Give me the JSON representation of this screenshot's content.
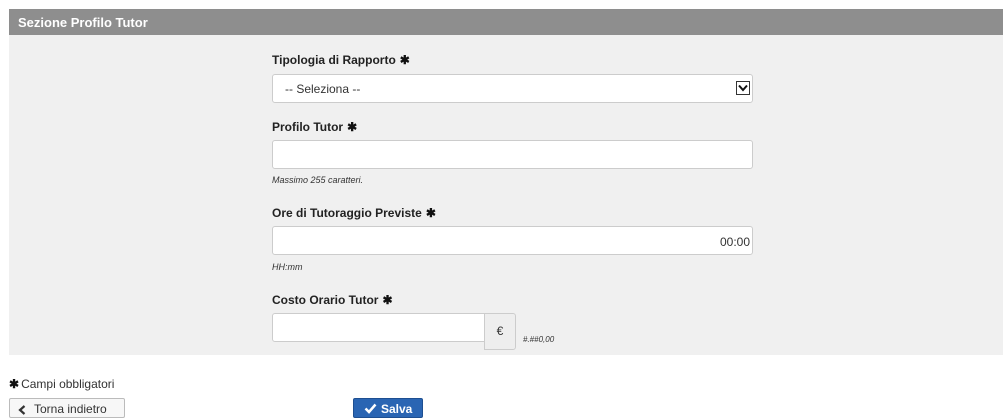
{
  "panel": {
    "title": "Sezione Profilo Tutor"
  },
  "form": {
    "tipologia": {
      "label": "Tipologia di Rapporto",
      "selected": "-- Seleziona --"
    },
    "profilo": {
      "label": "Profilo Tutor",
      "value": "",
      "hint": "Massimo 255 caratteri."
    },
    "ore": {
      "label": "Ore di Tutoraggio Previste",
      "value": "00:00",
      "hint": "HH:mm"
    },
    "costo": {
      "label": "Costo Orario Tutor",
      "value": "",
      "currency": "€",
      "format_hint": "#.##0,00"
    },
    "required_marker": "✱"
  },
  "footer": {
    "legend": "Campi obbligatori",
    "back_label": "Torna indietro",
    "save_label": "Salva"
  },
  "colors": {
    "header_bg": "#8e8e8e",
    "panel_bg": "#f0f0f0",
    "primary_button": "#2a65b3"
  }
}
